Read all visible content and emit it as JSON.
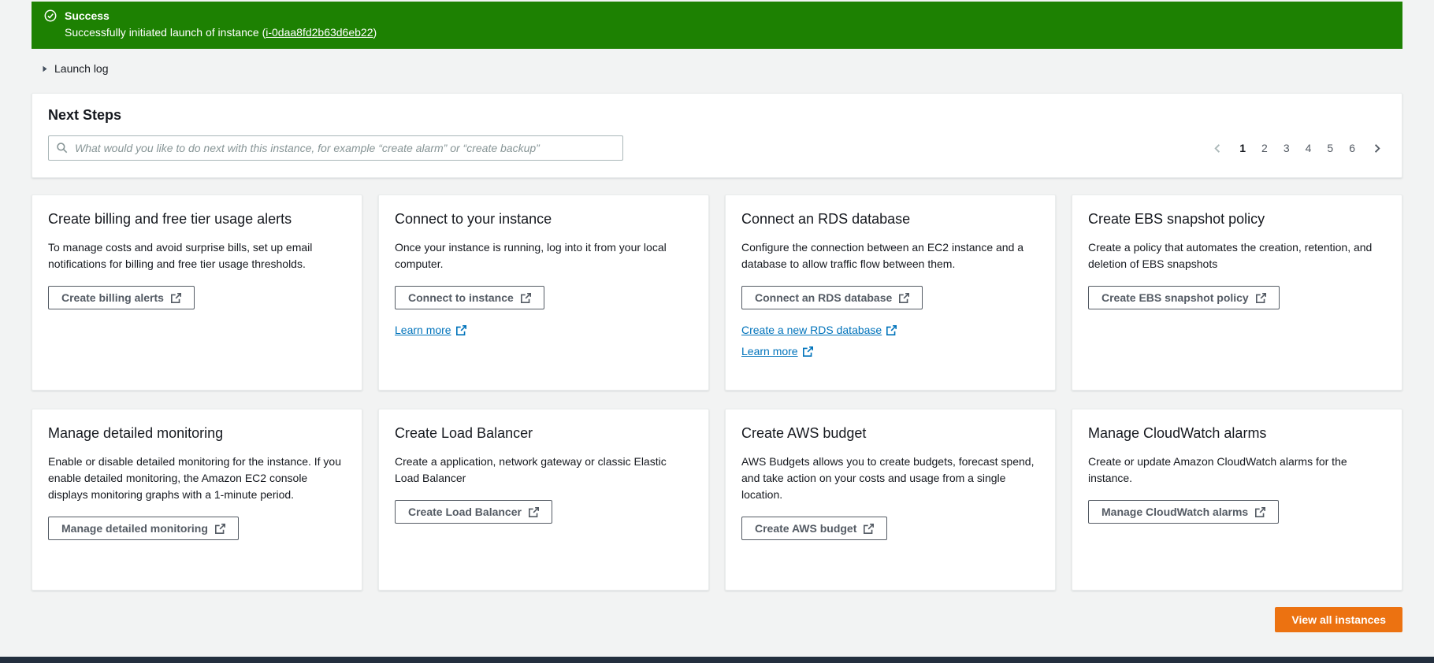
{
  "colors": {
    "success_green": "#1d8102",
    "primary_orange": "#ec7211",
    "link_blue": "#0073bb"
  },
  "flashbar": {
    "title": "Success",
    "message_prefix": "Successfully initiated launch of instance (",
    "instance_id": "i-0daa8fd2b63d6eb22",
    "message_suffix": ")"
  },
  "launch_log": {
    "label": "Launch log"
  },
  "next_steps": {
    "title": "Next Steps",
    "search_placeholder": "What would you like to do next with this instance, for example “create alarm” or “create backup”",
    "pagination": {
      "pages": [
        "1",
        "2",
        "3",
        "4",
        "5",
        "6"
      ],
      "active_page": "1"
    }
  },
  "cards": [
    {
      "title": "Create billing and free tier usage alerts",
      "description": "To manage costs and avoid surprise bills, set up email notifications for billing and free tier usage thresholds.",
      "button": "Create billing alerts",
      "links": []
    },
    {
      "title": "Connect to your instance",
      "description": "Once your instance is running, log into it from your local computer.",
      "button": "Connect to instance",
      "links": [
        "Learn more"
      ]
    },
    {
      "title": "Connect an RDS database",
      "description": "Configure the connection between an EC2 instance and a database to allow traffic flow between them.",
      "button": "Connect an RDS database",
      "links": [
        "Create a new RDS database",
        "Learn more"
      ]
    },
    {
      "title": "Create EBS snapshot policy",
      "description": "Create a policy that automates the creation, retention, and deletion of EBS snapshots",
      "button": "Create EBS snapshot policy",
      "links": []
    },
    {
      "title": "Manage detailed monitoring",
      "description": "Enable or disable detailed monitoring for the instance. If you enable detailed monitoring, the Amazon EC2 console displays monitoring graphs with a 1-minute period.",
      "button": "Manage detailed monitoring",
      "links": []
    },
    {
      "title": "Create Load Balancer",
      "description": "Create a application, network gateway or classic Elastic Load Balancer",
      "button": "Create Load Balancer",
      "links": []
    },
    {
      "title": "Create AWS budget",
      "description": "AWS Budgets allows you to create budgets, forecast spend, and take action on your costs and usage from a single location.",
      "button": "Create AWS budget",
      "links": []
    },
    {
      "title": "Manage CloudWatch alarms",
      "description": "Create or update Amazon CloudWatch alarms for the instance.",
      "button": "Manage CloudWatch alarms",
      "links": []
    }
  ],
  "footer": {
    "view_all_label": "View all instances"
  }
}
